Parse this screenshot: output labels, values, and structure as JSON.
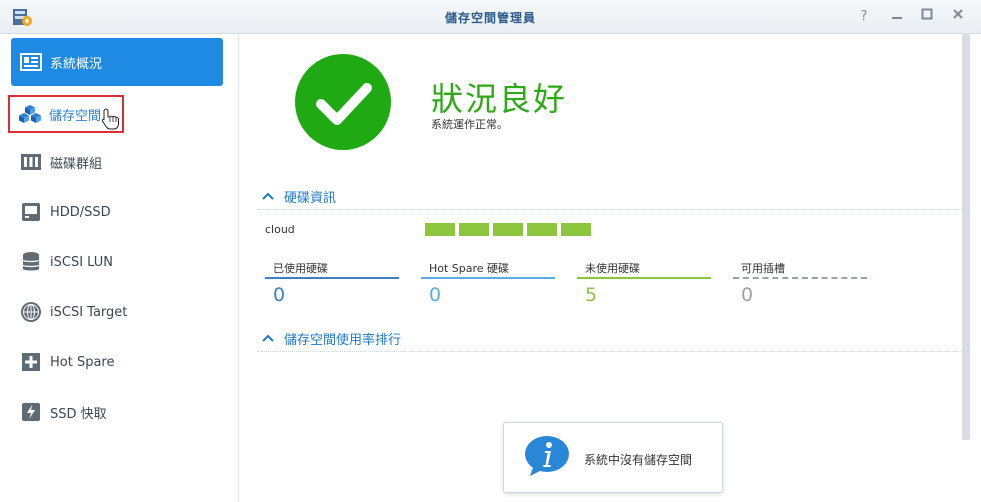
{
  "window": {
    "title": "儲存空間管理員",
    "help_label": "?",
    "minimize_label": "—",
    "maximize_label": "□",
    "close_label": "✕"
  },
  "sidebar": {
    "items": [
      {
        "label": "系統概況",
        "icon": "overview-icon"
      },
      {
        "label": "儲存空間",
        "icon": "storage-cubes-icon"
      },
      {
        "label": "磁碟群組",
        "icon": "disk-group-icon"
      },
      {
        "label": "HDD/SSD",
        "icon": "hdd-icon"
      },
      {
        "label": "iSCSI LUN",
        "icon": "database-icon"
      },
      {
        "label": "iSCSI Target",
        "icon": "globe-icon"
      },
      {
        "label": "Hot Spare",
        "icon": "plus-box-icon"
      },
      {
        "label": "SSD 快取",
        "icon": "ssd-icon"
      }
    ],
    "active_index": 0,
    "highlighted_index": 1
  },
  "status": {
    "title": "狀況良好",
    "subtitle": "系統運作正常。",
    "icon": "checkmark-icon",
    "color": "#1faa13"
  },
  "disk_info": {
    "header": "硬碟資訊",
    "server_name": "cloud",
    "slot_count": 5,
    "slot_color": "#8cc63f",
    "stats": [
      {
        "label": "已使用硬碟",
        "value": "0",
        "color": "#3d7ec4"
      },
      {
        "label": "Hot Spare 硬碟",
        "value": "0",
        "color": "#5aaee6"
      },
      {
        "label": "未使用硬碟",
        "value": "5",
        "color": "#8cc63f"
      },
      {
        "label": "可用插槽",
        "value": "0",
        "color": "#9aa3aa"
      }
    ]
  },
  "usage_ranking": {
    "header": "儲存空間使用率排行"
  },
  "toast": {
    "icon": "info-icon",
    "message": "系統中沒有儲存空間"
  }
}
